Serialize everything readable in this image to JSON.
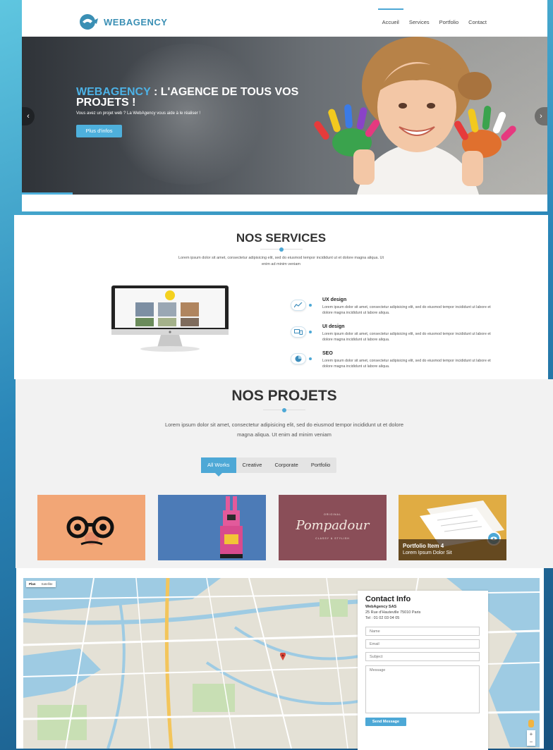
{
  "header": {
    "logo_text": "WEBAGENCY",
    "nav": [
      {
        "label": "Accueil",
        "active": true
      },
      {
        "label": "Services",
        "active": false
      },
      {
        "label": "Portfolio",
        "active": false
      },
      {
        "label": "Contact",
        "active": false
      }
    ]
  },
  "hero": {
    "title_brand": "WEBAGENCY",
    "title_rest": " : L'AGENCE DE TOUS VOS PROJETS !",
    "subtitle": "Vous avez un projet web ? La WebAgency vous aide à le réaliser !",
    "button": "Plus d'infos",
    "arrow_left": "‹",
    "arrow_right": "›"
  },
  "services": {
    "title": "NOS SERVICES",
    "lead": "Lorem ipsum dolor sit amet, consectetur adipisicing elit, sed do eiusmod tempor incididunt ut et dolore magna aliqua. Ut enim ad minim veniam",
    "items": [
      {
        "name": "UX design",
        "icon": "chart-icon",
        "desc": "Lorem ipsum dolor sit amet, consectetur adipisicing elit, sed do eiusmod tempor incididunt ut labore et dolore magna incididunt ut labore aliqua."
      },
      {
        "name": "UI design",
        "icon": "devices-icon",
        "desc": "Lorem ipsum dolor sit amet, consectetur adipisicing elit, sed do eiusmod tempor incididunt ut labore et dolore magna incididunt ut labore aliqua."
      },
      {
        "name": "SEO",
        "icon": "pie-chart-icon",
        "desc": "Lorem ipsum dolor sit amet, consectetur adipisicing elit, sed do eiusmod tempor incididunt ut labore et dolore magna incididunt ut labore aliqua."
      }
    ]
  },
  "projects": {
    "title": "NOS PROJETS",
    "lead": "Lorem ipsum dolor sit amet, consectetur adipisicing elit, sed do eiusmod tempor incididunt ut et dolore magna aliqua. Ut enim ad minim veniam",
    "filters": [
      {
        "label": "All Works",
        "active": true
      },
      {
        "label": "Creative",
        "active": false
      },
      {
        "label": "Corporate",
        "active": false
      },
      {
        "label": "Portfolio",
        "active": false
      }
    ],
    "tiles": [
      {
        "image": "glasses-illustration"
      },
      {
        "image": "pink-bunny-robot"
      },
      {
        "image": "pompadour-logo",
        "logo_text": "Pompadour",
        "logo_top": "ORIGINAL",
        "logo_bottom": "CLASSY & STYLISH"
      },
      {
        "image": "documents-photo",
        "name": "Portfolio Item 4",
        "sub": "Lorem Ipsum Dolor Sit",
        "icon": "eye-icon"
      }
    ]
  },
  "map": {
    "tabs": [
      {
        "label": "Plan",
        "active": true
      },
      {
        "label": "Satellite",
        "active": false
      }
    ],
    "zoom_in": "+",
    "zoom_out": "−"
  },
  "contact": {
    "title": "Contact Info",
    "company": "WebAgency SAS",
    "address": "25 Rue d'Hauteville 75010 Paris",
    "tel": "Tel : 01 02 03 04 05",
    "name_placeholder": "Name",
    "email_placeholder": "Email",
    "subject_placeholder": "Subject",
    "message_placeholder": "Message",
    "button": "Send Message"
  },
  "colors": {
    "accent": "#4da8d6",
    "background_gradient": [
      "#5fc6e0",
      "#17517f"
    ]
  }
}
